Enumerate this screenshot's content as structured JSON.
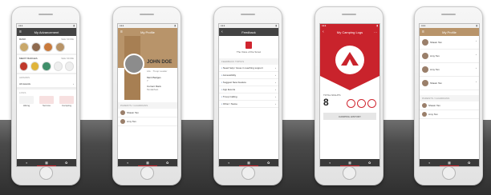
{
  "screens": {
    "advancement": {
      "title": "My Advancement",
      "sections": {
        "rank": {
          "label": "RANK",
          "action": "SEE MORE"
        },
        "merit": {
          "label": "MERIT BADGES",
          "action": "SEE MORE"
        },
        "awards": {
          "label": "AWARDS",
          "item": "All Awards"
        },
        "logs": {
          "label": "LOGS",
          "items": [
            "Hiking",
            "Service",
            "Camping"
          ]
        }
      }
    },
    "profile": {
      "title": "My Profile",
      "name": "JOHN DOE",
      "sub": "Life · Troop Leader",
      "merit_label": "Merit Badges",
      "merit_value": "7",
      "rank_label": "Current Rank",
      "rank_value": "Tenderfoot",
      "parents_label": "PARENTS / GUARDIANS",
      "parents": [
        "Shawn Tan",
        "Amy Tan"
      ]
    },
    "feedback": {
      "title": "Feedback",
      "hero_caption": "The Voice of the Scout",
      "topics_label": "FEEDBACK TOPICS",
      "topics": [
        "Need help / Issue in reaching support",
        "Accessibility",
        "Suggest New Feature",
        "App Events",
        "Troop Calling",
        "Other / Name"
      ]
    },
    "camping": {
      "title": "My Camping Logs",
      "total_label": "TOTAL NIGHTS",
      "total_value": "8",
      "history_label": "CAMPING HISTORY"
    },
    "profile2": {
      "title": "My Profile",
      "people": [
        "Shawn Tan",
        "Amy Tan",
        "Amy Tan",
        "Shawn Tan"
      ],
      "parents_label": "PARENTS / GUARDIANS",
      "parents": [
        "Shawn Tan",
        "Amy Tan"
      ]
    }
  },
  "colors": {
    "accent": "#d0252f",
    "header": "#434343",
    "tan": "#b8946a"
  }
}
